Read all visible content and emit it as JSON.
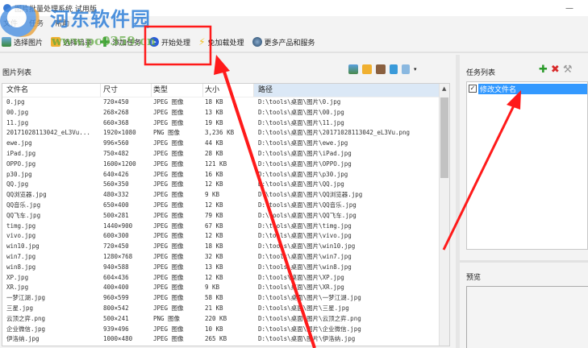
{
  "window": {
    "title": "图片批量处理系统 试用版",
    "minimize": "—"
  },
  "menu": [
    "文件",
    "任务",
    "帮助"
  ],
  "toolbar": [
    "选择图片",
    "选择目录",
    "添加任务",
    "开始处理",
    "免加载处理",
    "更多产品和服务"
  ],
  "watermark": {
    "name": "河东软件园",
    "url": "www.pc0359.cn"
  },
  "left": {
    "label": "图片列表",
    "columns": [
      "文件名",
      "尺寸",
      "类型",
      "大小",
      "路径"
    ],
    "rows": [
      [
        "0.jpg",
        "720×450",
        "JPEG 图像",
        "18 KB",
        "D:\\tools\\桌面\\图片\\0.jpg"
      ],
      [
        "00.jpg",
        "268×268",
        "JPEG 图像",
        "13 KB",
        "D:\\tools\\桌面\\图片\\00.jpg"
      ],
      [
        "11.jpg",
        "660×368",
        "JPEG 图像",
        "19 KB",
        "D:\\tools\\桌面\\图片\\11.jpg"
      ],
      [
        "20171028113042_eL3Vu...",
        "1920×1080",
        "PNG 图像",
        "3,236 KB",
        "D:\\tools\\桌面\\图片\\20171028113042_eL3Vu.png"
      ],
      [
        "ewe.jpg",
        "996×560",
        "JPEG 图像",
        "44 KB",
        "D:\\tools\\桌面\\图片\\ewe.jpg"
      ],
      [
        "iPad.jpg",
        "750×482",
        "JPEG 图像",
        "28 KB",
        "D:\\tools\\桌面\\图片\\iPad.jpg"
      ],
      [
        "OPPO.jpg",
        "1600×1200",
        "JPEG 图像",
        "121 KB",
        "D:\\tools\\桌面\\图片\\OPPO.jpg"
      ],
      [
        "p30.jpg",
        "640×426",
        "JPEG 图像",
        "16 KB",
        "D:\\tools\\桌面\\图片\\p30.jpg"
      ],
      [
        "QQ.jpg",
        "560×350",
        "JPEG 图像",
        "12 KB",
        "D:\\tools\\桌面\\图片\\QQ.jpg"
      ],
      [
        "QQ浏览器.jpg",
        "480×332",
        "JPEG 图像",
        "9 KB",
        "D:\\tools\\桌面\\图片\\QQ浏览器.jpg"
      ],
      [
        "QQ音乐.jpg",
        "650×400",
        "JPEG 图像",
        "12 KB",
        "D:\\tools\\桌面\\图片\\QQ音乐.jpg"
      ],
      [
        "QQ飞车.jpg",
        "500×281",
        "JPEG 图像",
        "79 KB",
        "D:\\tools\\桌面\\图片\\QQ飞车.jpg"
      ],
      [
        "timg.jpg",
        "1440×900",
        "JPEG 图像",
        "67 KB",
        "D:\\tools\\桌面\\图片\\timg.jpg"
      ],
      [
        "vivo.jpg",
        "600×300",
        "JPEG 图像",
        "12 KB",
        "D:\\tools\\桌面\\图片\\vivo.jpg"
      ],
      [
        "win10.jpg",
        "720×450",
        "JPEG 图像",
        "18 KB",
        "D:\\tools\\桌面\\图片\\win10.jpg"
      ],
      [
        "win7.jpg",
        "1280×768",
        "JPEG 图像",
        "32 KB",
        "D:\\tools\\桌面\\图片\\win7.jpg"
      ],
      [
        "win8.jpg",
        "940×588",
        "JPEG 图像",
        "13 KB",
        "D:\\tools\\桌面\\图片\\win8.jpg"
      ],
      [
        "XP.jpg",
        "604×436",
        "JPEG 图像",
        "12 KB",
        "D:\\tools\\桌面\\图片\\XP.jpg"
      ],
      [
        "XR.jpg",
        "400×400",
        "JPEG 图像",
        "9 KB",
        "D:\\tools\\桌面\\图片\\XR.jpg"
      ],
      [
        "一梦江湖.jpg",
        "960×599",
        "JPEG 图像",
        "58 KB",
        "D:\\tools\\桌面\\图片\\一梦江湖.jpg"
      ],
      [
        "三星.jpg",
        "800×542",
        "JPEG 图像",
        "21 KB",
        "D:\\tools\\桌面\\图片\\三星.jpg"
      ],
      [
        "云顶之弈.png",
        "500×241",
        "PNG 图像",
        "220 KB",
        "D:\\tools\\桌面\\图片\\云顶之弈.png"
      ],
      [
        "企业微信.jpg",
        "939×496",
        "JPEG 图像",
        "10 KB",
        "D:\\tools\\桌面\\图片\\企业微信.jpg"
      ],
      [
        "伊洛纳.jpg",
        "1000×480",
        "JPEG 图像",
        "265 KB",
        "D:\\tools\\桌面\\图片\\伊洛纳.jpg"
      ]
    ]
  },
  "right": {
    "task_label": "任务列表",
    "tasks": [
      {
        "label": "修改文件名",
        "checked": true
      }
    ],
    "preview_label": "预览"
  },
  "colors": {
    "accent": "#3399ff",
    "highlight": "#ff2020"
  }
}
